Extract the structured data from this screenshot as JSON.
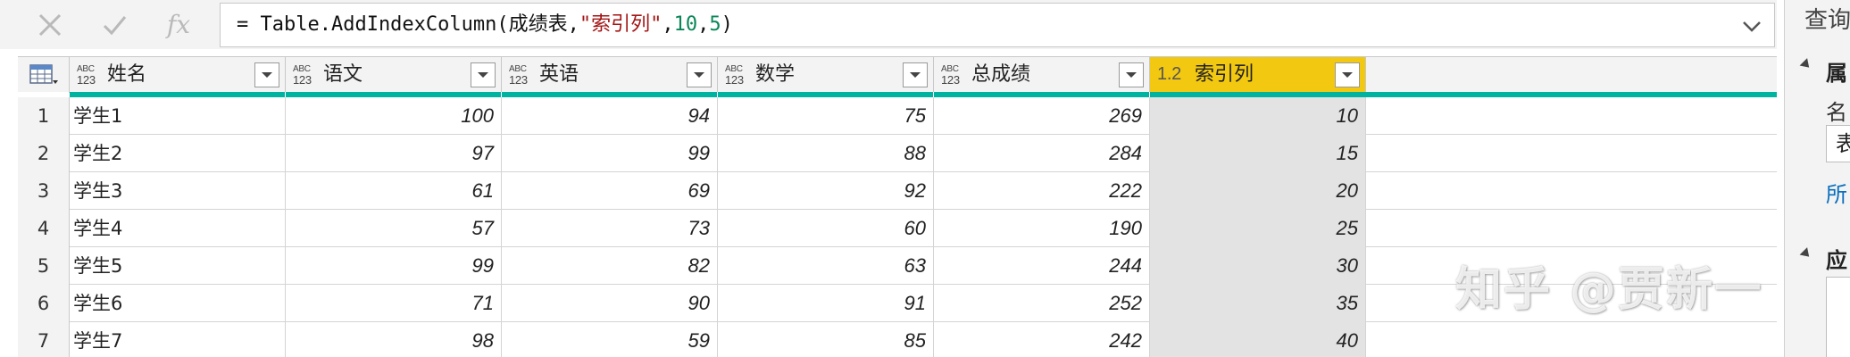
{
  "formula_bar": {
    "cancel_icon": "x-icon",
    "confirm_icon": "check-icon",
    "fx_label": "fx",
    "formula_prefix": "= Table.AddIndexColumn(成绩表,",
    "formula_string": "\"索引列\"",
    "formula_comma1": ",",
    "formula_num1": "10",
    "formula_comma2": ",",
    "formula_num2": "5",
    "formula_suffix": ")"
  },
  "grid": {
    "corner_icon": "table-icon",
    "columns": [
      {
        "type_top": "ABC",
        "type_bottom": "123",
        "name": "姓名"
      },
      {
        "type_top": "ABC",
        "type_bottom": "123",
        "name": "语文"
      },
      {
        "type_top": "ABC",
        "type_bottom": "123",
        "name": "英语"
      },
      {
        "type_top": "ABC",
        "type_bottom": "123",
        "name": "数学"
      },
      {
        "type_top": "ABC",
        "type_bottom": "123",
        "name": "总成绩"
      },
      {
        "type_top": "1.2",
        "type_bottom": "",
        "name": "索引列"
      }
    ],
    "rows": [
      {
        "n": "1",
        "c": [
          "学生1",
          "100",
          "94",
          "75",
          "269",
          "10"
        ]
      },
      {
        "n": "2",
        "c": [
          "学生2",
          "97",
          "99",
          "88",
          "284",
          "15"
        ]
      },
      {
        "n": "3",
        "c": [
          "学生3",
          "61",
          "69",
          "92",
          "222",
          "20"
        ]
      },
      {
        "n": "4",
        "c": [
          "学生4",
          "57",
          "73",
          "60",
          "190",
          "25"
        ]
      },
      {
        "n": "5",
        "c": [
          "学生5",
          "99",
          "82",
          "63",
          "244",
          "30"
        ]
      },
      {
        "n": "6",
        "c": [
          "学生6",
          "71",
          "90",
          "91",
          "252",
          "35"
        ]
      },
      {
        "n": "7",
        "c": [
          "学生7",
          "98",
          "59",
          "85",
          "242",
          "40"
        ]
      }
    ]
  },
  "right_panel": {
    "title": "查询",
    "section1": "属",
    "label_name": "名",
    "input_value": "表",
    "link": "所",
    "section2": "应"
  },
  "watermark": "知乎 @贾新一",
  "colors": {
    "accent_teal": "#00b3a1",
    "selected_header": "#f2c811",
    "string_red": "#a31515",
    "number_green": "#098658"
  }
}
